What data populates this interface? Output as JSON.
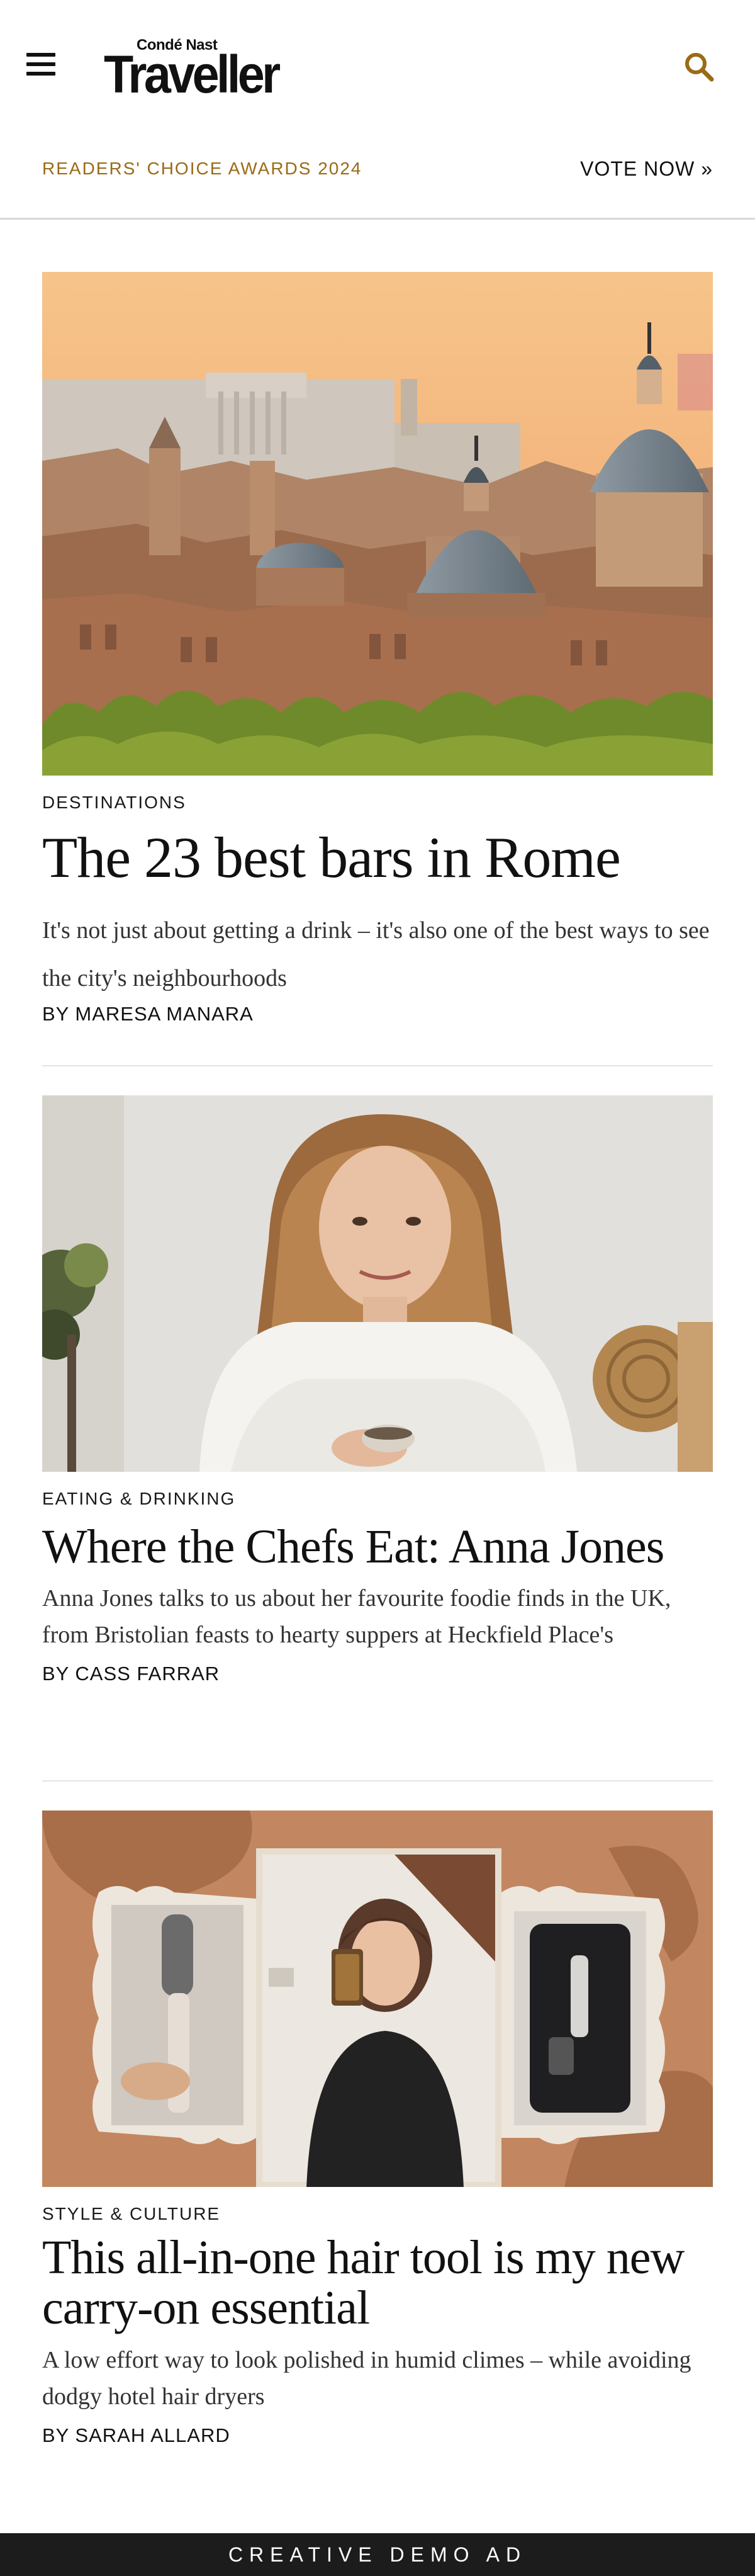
{
  "header": {
    "brand_top": "Condé Nast",
    "brand_main": "Traveller",
    "promo_text": "READERS' CHOICE AWARDS 2024",
    "promo_link": "VOTE NOW »"
  },
  "articles": [
    {
      "rubric": "DESTINATIONS",
      "headline": "The 23 best bars in Rome",
      "dek": "It's not just about getting a drink – it's also one of the best ways to see the city's neighbourhoods",
      "byline": "BY MARESA MANARA"
    },
    {
      "rubric": "EATING & DRINKING",
      "headline": "Where the Chefs Eat: Anna Jones",
      "dek": "Anna Jones talks to us about her favourite foodie finds in the UK, from Bristolian feasts to hearty suppers at Heckfield Place's",
      "byline": "BY CASS FARRAR"
    },
    {
      "rubric": "STYLE & CULTURE",
      "headline": "This all-in-one hair tool is my new carry-on essential",
      "dek": "A low effort way to look polished in humid climes – while avoiding dodgy hotel hair dryers",
      "byline": "BY SARAH ALLARD"
    }
  ],
  "ad": {
    "label": "CREATIVE DEMO AD"
  },
  "icons": {
    "menu": "hamburger-menu-icon",
    "search": "search-icon"
  },
  "colors": {
    "accent": "#9a6b16",
    "ad_bar": "#1c1c1c"
  }
}
